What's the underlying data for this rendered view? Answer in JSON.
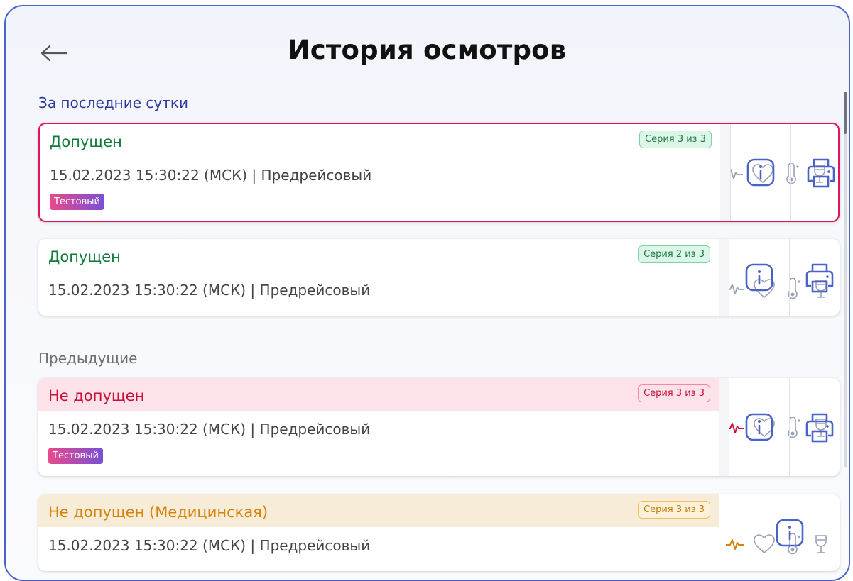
{
  "header": {
    "title": "История осмотров",
    "back_icon": "arrow-left-icon"
  },
  "sections": [
    {
      "label": "За последние сутки"
    },
    {
      "label": "Предыдущие"
    }
  ],
  "cards": [
    {
      "status": "Допущен",
      "series": "Серия 3 из 3",
      "datetime": "15.02.2023 15:30:22 (МСК) | Предрейсовый",
      "tag": "Тестовый",
      "type": "ok",
      "active": true
    },
    {
      "status": "Допущен",
      "series": "Серия 2 из 3",
      "datetime": "15.02.2023 15:30:22 (МСК) | Предрейсовый",
      "type": "ok"
    },
    {
      "status": "Не допущен",
      "series": "Серия 3 из 3",
      "datetime": "15.02.2023 15:30:22 (МСК) | Предрейсовый",
      "tag": "Тестовый",
      "type": "bad"
    },
    {
      "status": "Не допущен (Медицинская)",
      "series": "Серия 3 из 3",
      "datetime": "15.02.2023 15:30:22 (МСК) | Предрейсовый",
      "type": "med"
    }
  ],
  "colors": {
    "ok": "#137a3c",
    "bad": "#c8103a",
    "med": "#d98208",
    "accent": "#4a63c9"
  }
}
